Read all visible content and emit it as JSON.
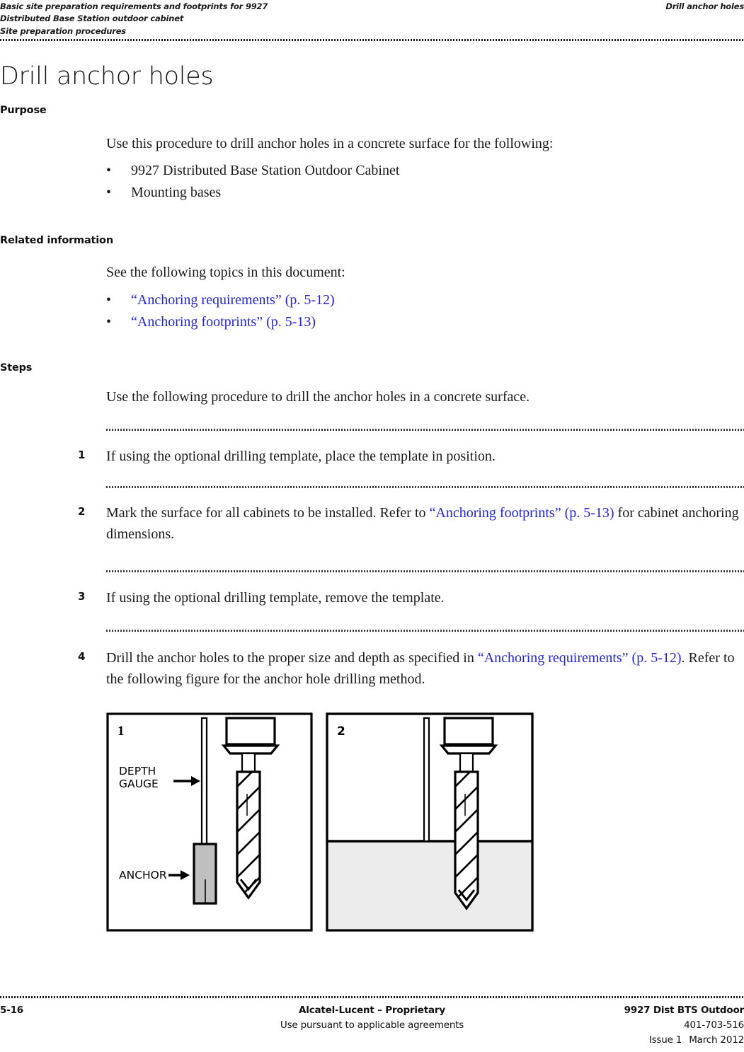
{
  "header": {
    "left_lines": [
      "Basic site preparation requirements and footprints for 9927",
      "Distributed Base Station outdoor cabinet",
      "Site preparation procedures"
    ],
    "right": "Drill anchor holes"
  },
  "title": "Drill anchor holes",
  "sections": {
    "purpose": {
      "heading": "Purpose",
      "intro": "Use this procedure to drill anchor holes in a concrete surface for the following:",
      "bullets": [
        "9927 Distributed Base Station Outdoor Cabinet",
        "Mounting bases"
      ]
    },
    "related": {
      "heading": "Related information",
      "intro": "See the following topics in this document:",
      "bullets": [
        "“Anchoring requirements” (p. 5-12)",
        "“Anchoring footprints” (p. 5-13)"
      ]
    },
    "steps": {
      "heading": "Steps",
      "intro": "Use the following procedure to drill the anchor holes in a concrete surface.",
      "items": [
        {
          "number": "1",
          "text_before": "If using the optional drilling template, place the template in position.",
          "link": "",
          "text_after": ""
        },
        {
          "number": "2",
          "text_before": "Mark the surface for all cabinets to be installed. Refer to ",
          "link": "“Anchoring footprints” (p. 5-13)",
          "text_after": " for cabinet anchoring dimensions."
        },
        {
          "number": "3",
          "text_before": "If using the optional drilling template, remove the template.",
          "link": "",
          "text_after": ""
        },
        {
          "number": "4",
          "text_before": "Drill the anchor holes to the proper size and depth as specified in ",
          "link": "“Anchoring requirements” (p. 5-12)",
          "text_after": ". Refer to the following figure for the anchor hole drilling method."
        }
      ]
    }
  },
  "figure": {
    "panel1": {
      "number": "1",
      "label_depth_line1": "DEPTH",
      "label_depth_line2": "GAUGE",
      "label_anchor": "ANCHOR"
    },
    "panel2": {
      "number": "2"
    },
    "colors": {
      "anchor_fill": "#bfbfbf",
      "concrete_fill": "#ececec",
      "outline": "#000000"
    }
  },
  "footer": {
    "page_number": "5-16",
    "center_line1": "Alcatel-Lucent – Proprietary",
    "center_line2": "Use pursuant to applicable agreements",
    "right_line1": "9927 Dist BTS Outdoor",
    "right_line2": "401-703-516",
    "right_line3a": "Issue 1",
    "right_line3b": "March 2012"
  },
  "link_color": "#2424d8"
}
